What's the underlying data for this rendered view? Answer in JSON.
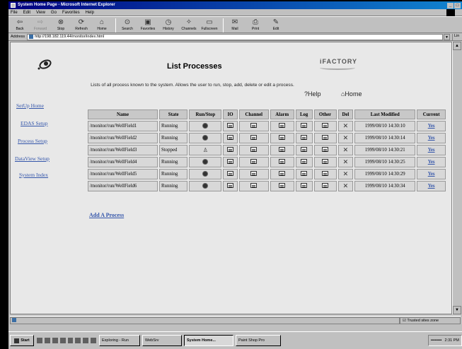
{
  "window": {
    "title": "System Home Page - Microsoft Internet Explorer"
  },
  "menu": [
    "File",
    "Edit",
    "View",
    "Go",
    "Favorites",
    "Help"
  ],
  "toolbar": [
    {
      "label": "Back",
      "icon": "back-icon",
      "enabled": true
    },
    {
      "label": "Forward",
      "icon": "forward-icon",
      "enabled": false
    },
    {
      "label": "Stop",
      "icon": "stop-icon",
      "enabled": true
    },
    {
      "label": "Refresh",
      "icon": "refresh-icon",
      "enabled": true
    },
    {
      "label": "Home",
      "icon": "home-icon",
      "enabled": true
    },
    {
      "label": "Search",
      "icon": "search-icon",
      "enabled": true
    },
    {
      "label": "Favorites",
      "icon": "favorites-icon",
      "enabled": true
    },
    {
      "label": "History",
      "icon": "history-icon",
      "enabled": true
    },
    {
      "label": "Channels",
      "icon": "channels-icon",
      "enabled": true
    },
    {
      "label": "Fullscreen",
      "icon": "fullscreen-icon",
      "enabled": true
    },
    {
      "label": "Mail",
      "icon": "mail-icon",
      "enabled": true
    },
    {
      "label": "Print",
      "icon": "print-icon",
      "enabled": true
    },
    {
      "label": "Edit",
      "icon": "edit-icon",
      "enabled": true
    }
  ],
  "address": {
    "label": "Address",
    "url": "http://198.182.119.44/monitor/index.html",
    "links_label": "Lin"
  },
  "sidebar": {
    "items": [
      {
        "label": "SetUp Home"
      },
      {
        "label": "EDAS Setup"
      },
      {
        "label": "Process Setup"
      },
      {
        "label": "DataView Setup"
      },
      {
        "label": "System Index"
      }
    ]
  },
  "page": {
    "title": "List Processes",
    "brand": "iFACTORY",
    "description": "Lists of all process known to the system. Allows the user to run, stop, add, delete or edit a process.",
    "help": "?Help",
    "home": "⌂Home"
  },
  "table": {
    "headers": [
      "Name",
      "State",
      "Run/Stop",
      "IO",
      "Channel",
      "Alarm",
      "Log",
      "Other",
      "Del",
      "Last Modified",
      "Current"
    ],
    "rows": [
      {
        "name": "/monitor/run/WellField1",
        "state": "Running",
        "action": "stop",
        "modified": "1999/08/10 14:30:10",
        "current": "Yes"
      },
      {
        "name": "/monitor/run/WellField2",
        "state": "Running",
        "action": "stop",
        "modified": "1999/08/10 14:30:14",
        "current": "Yes"
      },
      {
        "name": "/monitor/run/WellField3",
        "state": "Stopped",
        "action": "run",
        "modified": "1999/08/10 14:30:21",
        "current": "Yes"
      },
      {
        "name": "/monitor/run/WellField4",
        "state": "Running",
        "action": "stop",
        "modified": "1999/08/10 14:30:25",
        "current": "Yes"
      },
      {
        "name": "/monitor/run/WellField5",
        "state": "Running",
        "action": "stop",
        "modified": "1999/08/10 14:30:29",
        "current": "Yes"
      },
      {
        "name": "/monitor/run/WellField6",
        "state": "Running",
        "action": "stop",
        "modified": "1999/08/10 14:30:34",
        "current": "Yes"
      }
    ]
  },
  "add_process": "Add A Process",
  "statusbar": {
    "zone": "Trusted sites zone"
  },
  "taskbar": {
    "start": "Start",
    "tasks": [
      {
        "label": "Exploring - Run",
        "active": false
      },
      {
        "label": "WebSrv",
        "active": false
      },
      {
        "label": "System Home...",
        "active": true
      },
      {
        "label": "Paint Shop Pro",
        "active": false
      }
    ],
    "clock": "2:31 PM"
  }
}
